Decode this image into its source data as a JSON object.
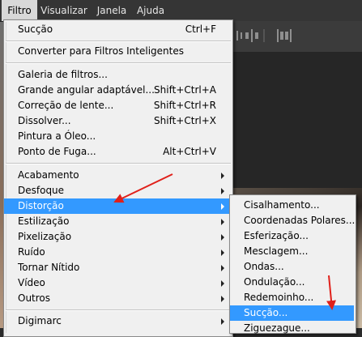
{
  "menubar": {
    "items": [
      {
        "label": "Filtro"
      },
      {
        "label": "Visualizar"
      },
      {
        "label": "Janela"
      },
      {
        "label": "Ajuda"
      }
    ]
  },
  "filter_menu": {
    "items": [
      {
        "label": "Sucção",
        "shortcut": "Ctrl+F"
      },
      {
        "label": "Converter para Filtros Inteligentes"
      },
      {
        "label": "Galeria de filtros..."
      },
      {
        "label": "Grande angular adaptável...",
        "shortcut": "Shift+Ctrl+A"
      },
      {
        "label": "Correção de lente...",
        "shortcut": "Shift+Ctrl+R"
      },
      {
        "label": "Dissolver...",
        "shortcut": "Shift+Ctrl+X"
      },
      {
        "label": "Pintura a Óleo..."
      },
      {
        "label": "Ponto de Fuga...",
        "shortcut": "Alt+Ctrl+V"
      },
      {
        "label": "Acabamento"
      },
      {
        "label": "Desfoque"
      },
      {
        "label": "Distorção"
      },
      {
        "label": "Estilização"
      },
      {
        "label": "Pixelização"
      },
      {
        "label": "Ruído"
      },
      {
        "label": "Tornar Nítido"
      },
      {
        "label": "Vídeo"
      },
      {
        "label": "Outros"
      },
      {
        "label": "Digimarc"
      }
    ]
  },
  "distortion_submenu": {
    "items": [
      {
        "label": "Cisalhamento..."
      },
      {
        "label": "Coordenadas Polares..."
      },
      {
        "label": "Esferização..."
      },
      {
        "label": "Mesclagem..."
      },
      {
        "label": "Ondas..."
      },
      {
        "label": "Ondulação..."
      },
      {
        "label": "Redemoinho..."
      },
      {
        "label": "Sucção..."
      },
      {
        "label": "Ziguezague..."
      }
    ]
  },
  "colors": {
    "highlight": "#3399ff",
    "annotation_arrow": "#e0201a"
  }
}
